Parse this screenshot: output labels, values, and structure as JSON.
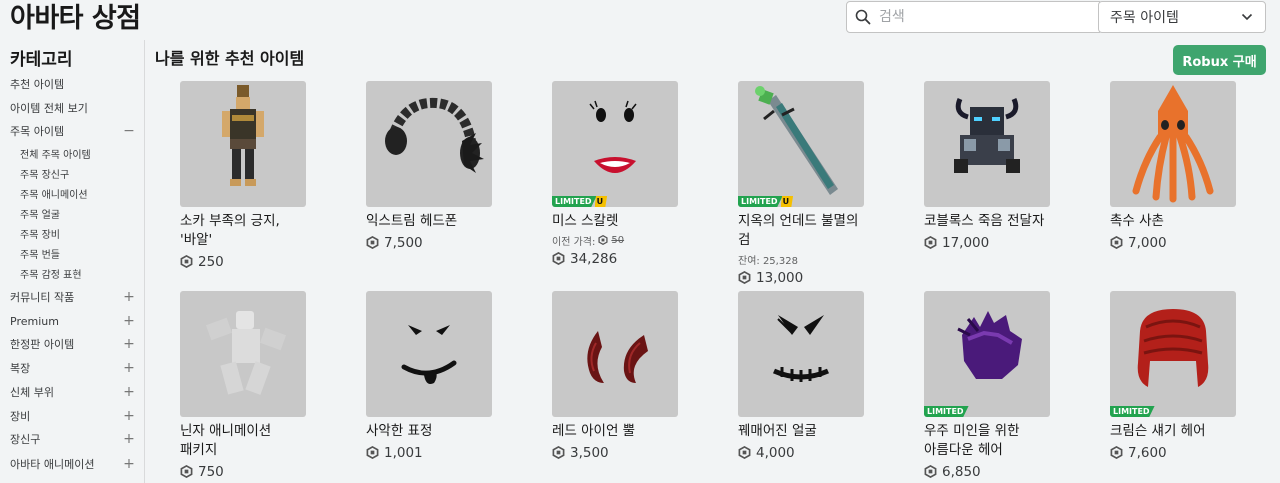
{
  "header": {
    "title": "아바타 상점",
    "search_placeholder": "검색",
    "sort_value": "주목 아이템"
  },
  "sidebar": {
    "title": "카테고리",
    "items": [
      {
        "label": "추천 아이템",
        "toggle": ""
      },
      {
        "label": "아이템 전체 보기",
        "toggle": ""
      },
      {
        "label": "주목 아이템",
        "toggle": "−"
      },
      {
        "label": "전체 주목 아이템",
        "toggle": ""
      },
      {
        "label": "주목 장신구",
        "toggle": ""
      },
      {
        "label": "주목 애니메이션",
        "toggle": ""
      },
      {
        "label": "주목 얼굴",
        "toggle": ""
      },
      {
        "label": "주목 장비",
        "toggle": ""
      },
      {
        "label": "주목 번들",
        "toggle": ""
      },
      {
        "label": "주목 감정 표현",
        "toggle": ""
      },
      {
        "label": "커뮤니티 작품",
        "toggle": "+"
      },
      {
        "label": "Premium",
        "toggle": "+"
      },
      {
        "label": "한정판 아이템",
        "toggle": "+"
      },
      {
        "label": "복장",
        "toggle": "+"
      },
      {
        "label": "신체 부위",
        "toggle": "+"
      },
      {
        "label": "장비",
        "toggle": "+"
      },
      {
        "label": "장신구",
        "toggle": "+"
      },
      {
        "label": "아바타 애니메이션",
        "toggle": "+"
      }
    ]
  },
  "main": {
    "section_title": "나를 위한 추천 아이템",
    "buy_robux_label": "Robux 구매",
    "items": [
      {
        "name": "소카 부족의 긍지, '바알'",
        "price": "250"
      },
      {
        "name": "익스트림 헤드폰",
        "price": "7,500"
      },
      {
        "name": "미스 스칼렛",
        "price": "34,286",
        "badge": "LIMITED",
        "badge_u": "U",
        "meta_label": "이전 가격:",
        "meta_value": "50"
      },
      {
        "name": "지옥의 언데드 불멸의 검",
        "price": "13,000",
        "badge": "LIMITED",
        "badge_u": "U",
        "meta_label": "잔여: 25,328"
      },
      {
        "name": "코블록스 죽음 전달자",
        "price": "17,000"
      },
      {
        "name": "촉수 사촌",
        "price": "7,000"
      },
      {
        "name": "닌자 애니메이션 패키지",
        "price": "750"
      },
      {
        "name": "사악한 표정",
        "price": "1,001"
      },
      {
        "name": "레드 아이언 뿔",
        "price": "3,500"
      },
      {
        "name": "꿰매어진 얼굴",
        "price": "4,000"
      },
      {
        "name": "우주 미인을 위한 아름다운 헤어",
        "price": "6,850",
        "badge": "LIMITED"
      },
      {
        "name": "크림슨 섀기 헤어",
        "price": "7,600",
        "badge": "LIMITED"
      }
    ]
  },
  "colors": {
    "background": "#f2f4f5",
    "buy_button": "#3fa56e",
    "limited_badge": "#22a34f",
    "unique_badge": "#f5c000",
    "thumbnail_bg": "#c8c8c8"
  },
  "icons": {
    "search": "search-icon",
    "sort": "chevron-down-icon",
    "currency": "robux-icon"
  }
}
